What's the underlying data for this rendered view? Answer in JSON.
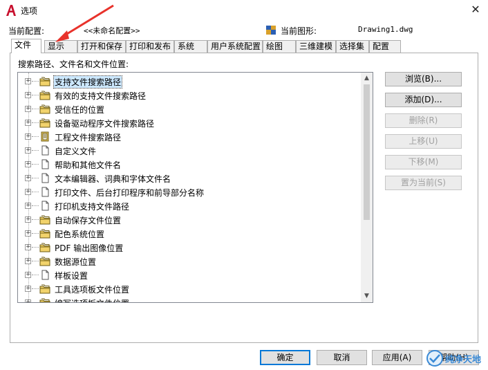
{
  "window": {
    "title": "选项",
    "close_glyph": "✕",
    "app_icon": "autocad-icon"
  },
  "profile": {
    "current_profile_label": "当前配置:",
    "current_profile_value": "<<未命名配置>>",
    "current_drawing_label": "当前图形:",
    "current_drawing_value": "Drawing1.dwg",
    "drawing_icon": "drawing-file-icon"
  },
  "tabs": [
    {
      "label": "文件",
      "active": true
    },
    {
      "label": "显示",
      "active": false
    },
    {
      "label": "打开和保存",
      "active": false
    },
    {
      "label": "打印和发布",
      "active": false
    },
    {
      "label": "系统",
      "active": false
    },
    {
      "label": "用户系统配置",
      "active": false
    },
    {
      "label": "绘图",
      "active": false
    },
    {
      "label": "三维建模",
      "active": false
    },
    {
      "label": "选择集",
      "active": false
    },
    {
      "label": "配置",
      "active": false
    }
  ],
  "files_tab": {
    "section_label": "搜索路径、文件名和文件位置:",
    "tree": [
      {
        "label": "支持文件搜索路径",
        "icon": "folder-stack-icon",
        "selected": true
      },
      {
        "label": "有效的支持文件搜索路径",
        "icon": "folder-stack-icon"
      },
      {
        "label": "受信任的位置",
        "icon": "folder-stack-icon"
      },
      {
        "label": "设备驱动程序文件搜索路径",
        "icon": "folder-stack-icon"
      },
      {
        "label": "工程文件搜索路径",
        "icon": "project-file-icon"
      },
      {
        "label": "自定义文件",
        "icon": "document-icon"
      },
      {
        "label": "帮助和其他文件名",
        "icon": "document-icon"
      },
      {
        "label": "文本编辑器、词典和字体文件名",
        "icon": "document-icon"
      },
      {
        "label": "打印文件、后台打印程序和前导部分名称",
        "icon": "document-icon"
      },
      {
        "label": "打印机支持文件路径",
        "icon": "document-icon"
      },
      {
        "label": "自动保存文件位置",
        "icon": "folder-stack-icon"
      },
      {
        "label": "配色系统位置",
        "icon": "folder-stack-icon"
      },
      {
        "label": "PDF 输出图像位置",
        "icon": "folder-stack-icon"
      },
      {
        "label": "数据源位置",
        "icon": "folder-stack-icon"
      },
      {
        "label": "样板设置",
        "icon": "document-icon"
      },
      {
        "label": "工具选项板文件位置",
        "icon": "folder-stack-icon"
      },
      {
        "label": "编写选项板文件位置",
        "icon": "folder-stack-icon"
      }
    ],
    "buttons": {
      "browse": "浏览(B)...",
      "add": "添加(D)...",
      "remove": "删除(R)",
      "move_up": "上移(U)",
      "move_down": "下移(M)",
      "set_current": "置为当前(S)"
    }
  },
  "footer": {
    "ok": "确定",
    "cancel": "取消",
    "apply": "应用(A)",
    "help": "帮助(H)"
  },
  "annotation": {
    "arrow_color": "#e8322b"
  },
  "watermark": {
    "text": "纯净天地"
  }
}
